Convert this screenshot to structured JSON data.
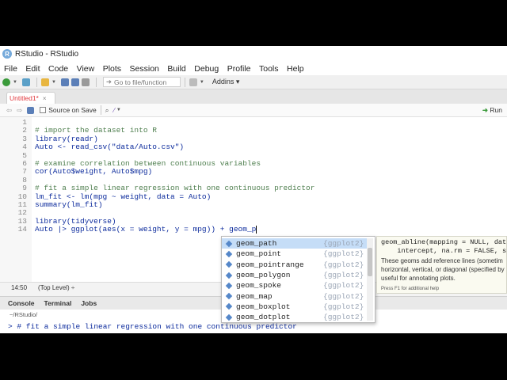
{
  "window": {
    "title": "RStudio - RStudio",
    "logo": "R"
  },
  "menu": [
    "File",
    "Edit",
    "Code",
    "View",
    "Plots",
    "Session",
    "Build",
    "Debug",
    "Profile",
    "Tools",
    "Help"
  ],
  "toolbar": {
    "goto_placeholder": "Go to file/function",
    "addins_label": "Addins"
  },
  "source": {
    "tab_label": "Untitled1*",
    "source_on_save": "Source on Save",
    "run_label": "Run",
    "lines": [
      {
        "n": "1",
        "text": "",
        "type": "code"
      },
      {
        "n": "2",
        "text": "# import the dataset into R",
        "type": "comment"
      },
      {
        "n": "3",
        "text": "library(readr)",
        "type": "code"
      },
      {
        "n": "4",
        "text": "Auto <- read_csv(\"data/Auto.csv\")",
        "type": "code"
      },
      {
        "n": "5",
        "text": "",
        "type": "code"
      },
      {
        "n": "6",
        "text": "# examine correlation between continuous variables",
        "type": "comment"
      },
      {
        "n": "7",
        "text": "cor(Auto$weight, Auto$mpg)",
        "type": "code"
      },
      {
        "n": "8",
        "text": "",
        "type": "code"
      },
      {
        "n": "9",
        "text": "# fit a simple linear regression with one continuous predictor",
        "type": "comment"
      },
      {
        "n": "10",
        "text": "lm_fit <- lm(mpg ~ weight, data = Auto)",
        "type": "code"
      },
      {
        "n": "11",
        "text": "summary(lm_fit)",
        "type": "code"
      },
      {
        "n": "12",
        "text": "",
        "type": "code"
      },
      {
        "n": "13",
        "text": "library(tidyverse)",
        "type": "code"
      },
      {
        "n": "14",
        "text": "Auto |> ggplot(aes(x = weight, y = mpg)) + geom_p",
        "type": "code"
      }
    ],
    "status_position": "14:50",
    "status_scope": "(Top Level) ÷"
  },
  "autocomplete": {
    "items": [
      {
        "name": "geom_path",
        "pkg": "{ggplot2}"
      },
      {
        "name": "geom_point",
        "pkg": "{ggplot2}"
      },
      {
        "name": "geom_pointrange",
        "pkg": "{ggplot2}"
      },
      {
        "name": "geom_polygon",
        "pkg": "{ggplot2}"
      },
      {
        "name": "geom_spoke",
        "pkg": "{ggplot2}"
      },
      {
        "name": "geom_map",
        "pkg": "{ggplot2}"
      },
      {
        "name": "geom_boxplot",
        "pkg": "{ggplot2}"
      },
      {
        "name": "geom_dotplot",
        "pkg": "{ggplot2}"
      }
    ],
    "selected_index": 0,
    "help_signature_1": "geom_abline(mapping = NULL, data",
    "help_signature_2": "    intercept, na.rm = FALSE, sh",
    "help_description": "These geoms add reference lines (sometim horizontal, vertical, or diagonal (specified by are useful for annotating plots.",
    "help_footer": "Press F1 for additional help"
  },
  "console": {
    "tabs": [
      "Console",
      "Terminal",
      "Jobs"
    ],
    "path": "~/RStudio/",
    "last_line": "> # fit a simple linear regression with one continuous predictor"
  },
  "colors": {
    "accent": "#75aadb",
    "selection": "#c5ddf7",
    "comment": "#4f7f4f",
    "code": "#0b2a9c"
  }
}
